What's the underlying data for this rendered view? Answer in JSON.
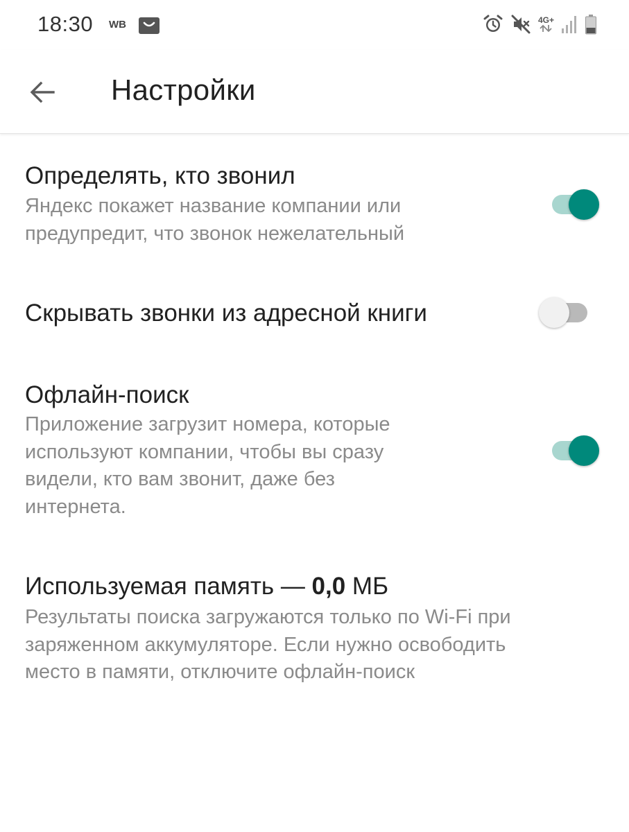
{
  "status_bar": {
    "time": "18:30",
    "app_badge": "WB",
    "network": "4G+"
  },
  "header": {
    "title": "Настройки"
  },
  "settings": {
    "caller_id": {
      "title": "Определять, кто звонил",
      "description_lines": [
        "Яндекс покажет название компании или",
        "предупредит, что звонок нежелательный"
      ],
      "enabled": true
    },
    "hide_contacts": {
      "title": "Скрывать звонки из адресной книги",
      "enabled": false
    },
    "offline_search": {
      "title": "Офлайн-поиск",
      "description_lines": [
        "Приложение загрузит номера, которые",
        "используют компании, чтобы вы сразу",
        "видели, кто вам звонит, даже без",
        "интернета."
      ],
      "enabled": true
    },
    "memory": {
      "title_prefix": "Используемая память — ",
      "value": "0,0",
      "unit": " МБ",
      "description_lines": [
        "Результаты поиска загружаются только по Wi-Fi при",
        "заряженном аккумуляторе. Если нужно освободить",
        "место в памяти, отключите офлайн-поиск"
      ]
    }
  },
  "colors": {
    "accent": "#00897b",
    "accent_track": "#a8d6cf",
    "switch_off_thumb": "#f1f1f1",
    "switch_off_track": "#b9b9b9",
    "secondary_text": "#8a8a8a"
  }
}
